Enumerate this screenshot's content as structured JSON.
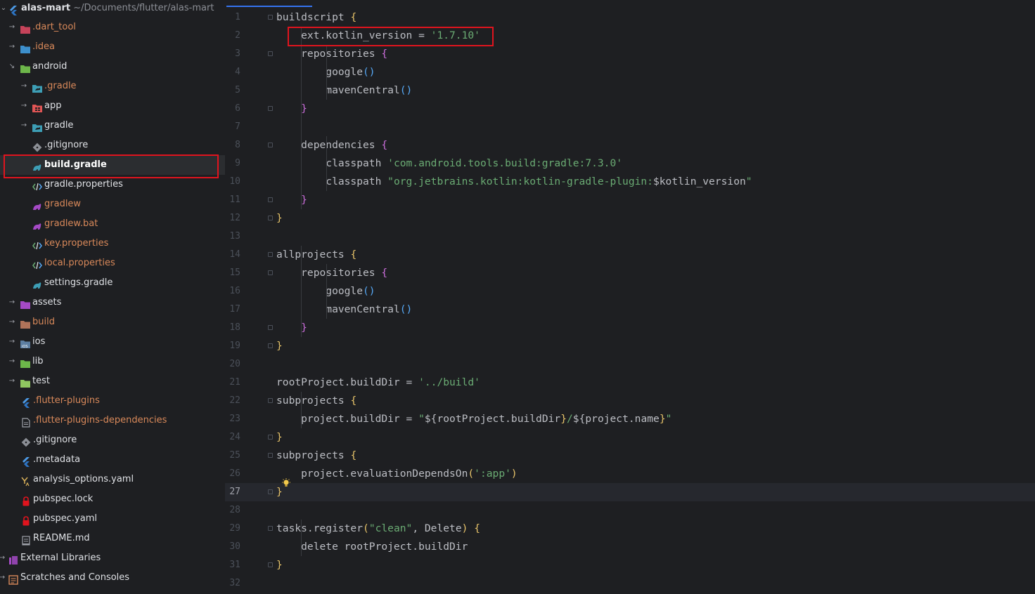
{
  "project": {
    "name": "alas-mart",
    "path": "~/Documents/flutter/alas-mart"
  },
  "tree": [
    {
      "label": ".dart_tool",
      "icon": "folder-icon",
      "arrow": "collapsed",
      "indent": 1,
      "color": "#d9895a",
      "iconColor": "#c6435a"
    },
    {
      "label": ".idea",
      "icon": "folder-icon",
      "arrow": "collapsed",
      "indent": 1,
      "color": "#d9895a",
      "iconColor": "#3d8fcc"
    },
    {
      "label": "android",
      "icon": "folder-icon",
      "arrow": "expanded",
      "indent": 1,
      "color": "#dfe1e5",
      "iconColor": "#6db64a"
    },
    {
      "label": ".gradle",
      "icon": "gradle-folder-icon",
      "arrow": "collapsed",
      "indent": 2,
      "color": "#d9895a",
      "iconColor": "#3d9eb5"
    },
    {
      "label": "app",
      "icon": "module-folder-icon",
      "arrow": "collapsed",
      "indent": 2,
      "color": "#dfe1e5",
      "iconColor": "#e05555"
    },
    {
      "label": "gradle",
      "icon": "gradle-folder-icon",
      "arrow": "collapsed",
      "indent": 2,
      "color": "#dfe1e5",
      "iconColor": "#3d9eb5"
    },
    {
      "label": ".gitignore",
      "icon": "git-icon",
      "arrow": "",
      "indent": 3,
      "color": "#dfe1e5",
      "iconColor": "#8c8f96"
    },
    {
      "label": "build.gradle",
      "icon": "gradle-icon",
      "arrow": "",
      "indent": 3,
      "color": "#ffffff",
      "iconColor": "#3d9eb5",
      "selected": true
    },
    {
      "label": "gradle.properties",
      "icon": "properties-icon",
      "arrow": "",
      "indent": 3,
      "color": "#dfe1e5",
      "iconColor": "#6aab73"
    },
    {
      "label": "gradlew",
      "icon": "gradle-icon",
      "arrow": "",
      "indent": 3,
      "color": "#d9895a",
      "iconColor": "#a54ac6"
    },
    {
      "label": "gradlew.bat",
      "icon": "gradle-icon",
      "arrow": "",
      "indent": 3,
      "color": "#d9895a",
      "iconColor": "#a54ac6"
    },
    {
      "label": "key.properties",
      "icon": "properties-icon",
      "arrow": "",
      "indent": 3,
      "color": "#d9895a",
      "iconColor": "#6aab73"
    },
    {
      "label": "local.properties",
      "icon": "properties-icon",
      "arrow": "",
      "indent": 3,
      "color": "#d9895a",
      "iconColor": "#6aab73"
    },
    {
      "label": "settings.gradle",
      "icon": "gradle-icon",
      "arrow": "",
      "indent": 3,
      "color": "#dfe1e5",
      "iconColor": "#3d9eb5"
    },
    {
      "label": "assets",
      "icon": "resource-folder-icon",
      "arrow": "collapsed",
      "indent": 1,
      "color": "#dfe1e5",
      "iconColor": "#a54ac6"
    },
    {
      "label": "build",
      "icon": "folder-icon",
      "arrow": "collapsed",
      "indent": 1,
      "color": "#d9895a",
      "iconColor": "#b0735a"
    },
    {
      "label": "ios",
      "icon": "ios-folder-icon",
      "arrow": "collapsed",
      "indent": 1,
      "color": "#dfe1e5",
      "iconColor": "#5d7fa3"
    },
    {
      "label": "lib",
      "icon": "source-folder-icon",
      "arrow": "collapsed",
      "indent": 1,
      "color": "#dfe1e5",
      "iconColor": "#6db64a"
    },
    {
      "label": "test",
      "icon": "test-folder-icon",
      "arrow": "collapsed",
      "indent": 1,
      "color": "#dfe1e5",
      "iconColor": "#8fc760"
    },
    {
      "label": ".flutter-plugins",
      "icon": "flutter-icon",
      "arrow": "",
      "indent": 2,
      "color": "#d9895a",
      "iconColor": "#4c9ae6"
    },
    {
      "label": ".flutter-plugins-dependencies",
      "icon": "file-icon",
      "arrow": "",
      "indent": 2,
      "color": "#d9895a",
      "iconColor": "#9da0a8"
    },
    {
      "label": ".gitignore",
      "icon": "git-icon",
      "arrow": "",
      "indent": 2,
      "color": "#dfe1e5",
      "iconColor": "#8c8f96"
    },
    {
      "label": ".metadata",
      "icon": "flutter-icon",
      "arrow": "",
      "indent": 2,
      "color": "#dfe1e5",
      "iconColor": "#4c9ae6"
    },
    {
      "label": "analysis_options.yaml",
      "icon": "yaml-icon",
      "arrow": "",
      "indent": 2,
      "color": "#dfe1e5",
      "iconColor": "#d9b15a"
    },
    {
      "label": "pubspec.lock",
      "icon": "lock-icon",
      "arrow": "",
      "indent": 2,
      "color": "#dfe1e5",
      "iconColor": "#e0141e"
    },
    {
      "label": "pubspec.yaml",
      "icon": "lock-icon",
      "arrow": "",
      "indent": 2,
      "color": "#dfe1e5",
      "iconColor": "#e0141e"
    },
    {
      "label": "README.md",
      "icon": "markdown-icon",
      "arrow": "",
      "indent": 2,
      "color": "#dfe1e5",
      "iconColor": "#9da0a8"
    },
    {
      "label": "External Libraries",
      "icon": "libraries-icon",
      "arrow": "collapsed",
      "indent": 0,
      "color": "#dfe1e5",
      "iconColor": "#a54ac6"
    },
    {
      "label": "Scratches and Consoles",
      "icon": "scratches-icon",
      "arrow": "collapsed",
      "indent": 0,
      "color": "#dfe1e5",
      "iconColor": "#d9895a"
    }
  ],
  "editor": {
    "current_line": 27,
    "lines": [
      [
        [
          "buildscript ",
          "t"
        ],
        [
          "{",
          "br1"
        ]
      ],
      [
        [
          "    ext.kotlin_version = ",
          "t"
        ],
        [
          "'1.7.10'",
          "str"
        ]
      ],
      [
        [
          "    repositories ",
          "t"
        ],
        [
          "{",
          "br2"
        ]
      ],
      [
        [
          "        google",
          "t"
        ],
        [
          "()",
          "br3"
        ]
      ],
      [
        [
          "        mavenCentral",
          "t"
        ],
        [
          "()",
          "br3"
        ]
      ],
      [
        [
          "    ",
          "t"
        ],
        [
          "}",
          "br2"
        ]
      ],
      [],
      [
        [
          "    dependencies ",
          "t"
        ],
        [
          "{",
          "br2"
        ]
      ],
      [
        [
          "        classpath ",
          "t"
        ],
        [
          "'com.android.tools.build:gradle:7.3.0'",
          "str"
        ]
      ],
      [
        [
          "        classpath ",
          "t"
        ],
        [
          "\"",
          "str"
        ],
        [
          "org.jetbrains.kotlin:kotlin-gradle-plugin:",
          "str"
        ],
        [
          "$kotlin_version",
          "t"
        ],
        [
          "\"",
          "str"
        ]
      ],
      [
        [
          "    ",
          "t"
        ],
        [
          "}",
          "br2"
        ]
      ],
      [
        [
          "}",
          "br1"
        ]
      ],
      [],
      [
        [
          "allprojects ",
          "t"
        ],
        [
          "{",
          "br1"
        ]
      ],
      [
        [
          "    repositories ",
          "t"
        ],
        [
          "{",
          "br2"
        ]
      ],
      [
        [
          "        google",
          "t"
        ],
        [
          "()",
          "br3"
        ]
      ],
      [
        [
          "        mavenCentral",
          "t"
        ],
        [
          "()",
          "br3"
        ]
      ],
      [
        [
          "    ",
          "t"
        ],
        [
          "}",
          "br2"
        ]
      ],
      [
        [
          "}",
          "br1"
        ]
      ],
      [],
      [
        [
          "rootProject.buildDir = ",
          "t"
        ],
        [
          "'../build'",
          "str"
        ]
      ],
      [
        [
          "subprojects ",
          "t"
        ],
        [
          "{",
          "br1"
        ]
      ],
      [
        [
          "    project.buildDir = ",
          "t"
        ],
        [
          "\"",
          "str"
        ],
        [
          "${",
          "t"
        ],
        [
          "rootProject.buildDir",
          "t"
        ],
        [
          "}",
          "br1"
        ],
        [
          "/",
          "str"
        ],
        [
          "${",
          "t"
        ],
        [
          "project.name",
          "t"
        ],
        [
          "}",
          "br1"
        ],
        [
          "\"",
          "str"
        ]
      ],
      [
        [
          "}",
          "br1"
        ]
      ],
      [
        [
          "subprojects ",
          "t"
        ],
        [
          "{",
          "br1"
        ]
      ],
      [
        [
          "    project.evaluationDependsOn",
          "t"
        ],
        [
          "(",
          "br1"
        ],
        [
          "':app'",
          "str"
        ],
        [
          ")",
          "br1"
        ]
      ],
      [
        [
          "}",
          "br1"
        ]
      ],
      [],
      [
        [
          "tasks.register",
          "t"
        ],
        [
          "(",
          "br1"
        ],
        [
          "\"clean\"",
          "str"
        ],
        [
          ", Delete",
          "t"
        ],
        [
          ")",
          "br1"
        ],
        [
          " ",
          "t"
        ],
        [
          "{",
          "br1"
        ]
      ],
      [
        [
          "    delete rootProject.buildDir",
          "t"
        ]
      ],
      [
        [
          "}",
          "br1"
        ]
      ],
      []
    ]
  },
  "colors": {
    "background": "#1e1f22",
    "highlight_box": "#e0141e",
    "string": "#6aab73",
    "keyword_text": "#bcbec4"
  }
}
